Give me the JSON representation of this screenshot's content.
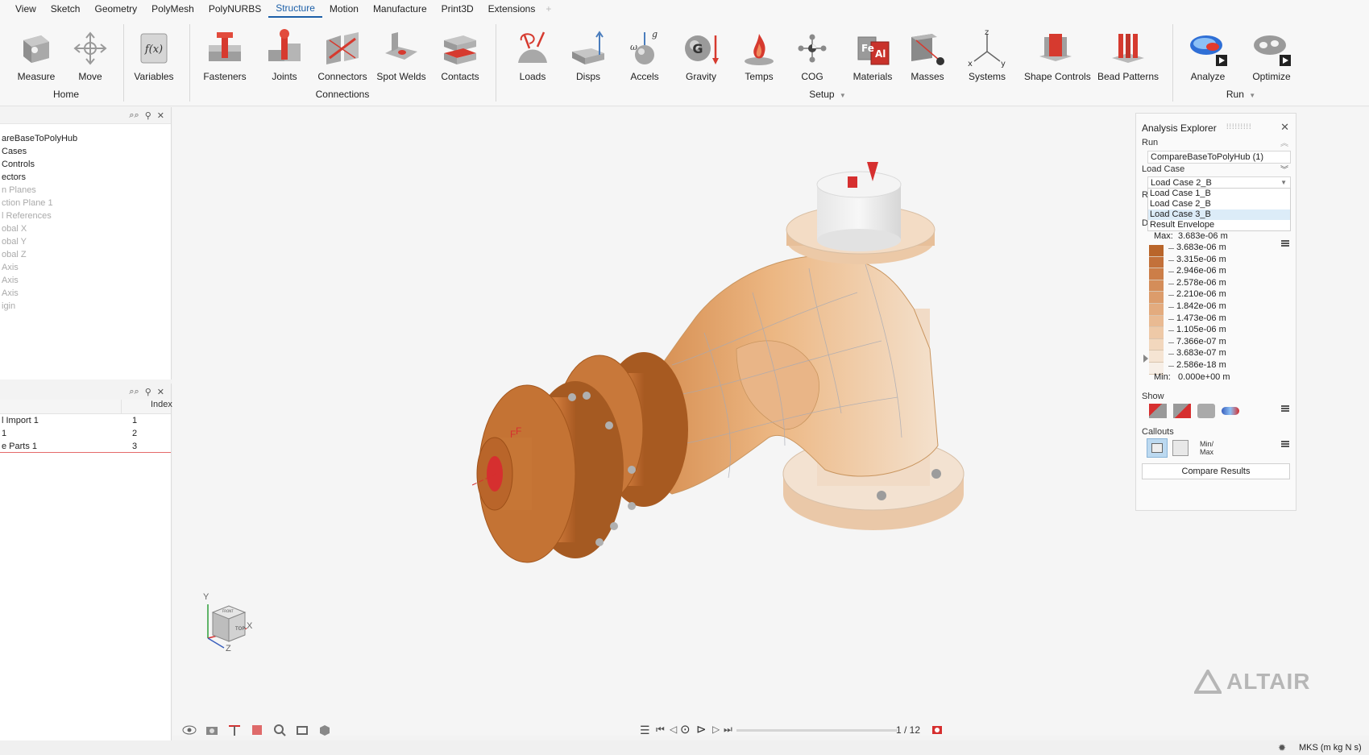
{
  "menubar": {
    "items": [
      "View",
      "Sketch",
      "Geometry",
      "PolyMesh",
      "PolyNURBS",
      "Structure",
      "Motion",
      "Manufacture",
      "Print3D",
      "Extensions"
    ],
    "active": "Structure",
    "plus": "+"
  },
  "ribbon": {
    "tools": {
      "measure": "Measure",
      "move": "Move",
      "variables": "Variables",
      "fasteners": "Fasteners",
      "joints": "Joints",
      "connectors": "Connectors",
      "spot_welds": "Spot Welds",
      "contacts": "Contacts",
      "loads": "Loads",
      "disps": "Disps",
      "accels": "Accels",
      "gravity": "Gravity",
      "temps": "Temps",
      "cog": "COG",
      "materials": "Materials",
      "masses": "Masses",
      "systems": "Systems",
      "shape_controls": "Shape Controls",
      "bead_patterns": "Bead Patterns",
      "analyze": "Analyze",
      "optimize": "Optimize"
    },
    "groups": {
      "home": "Home",
      "connections": "Connections",
      "setup": "Setup",
      "run": "Run"
    },
    "icon_text": {
      "variables_fx": "f(x)",
      "accels_omega": "ω",
      "accels_g": "g",
      "gravity_g": "G",
      "materials_fe": "Fe",
      "materials_al": "Al",
      "systems_x": "x",
      "systems_y": "y",
      "systems_z": "z"
    }
  },
  "model_browser": {
    "items": [
      {
        "label": "areBaseToPolyHub",
        "dim": false
      },
      {
        "label": "Cases",
        "dim": false
      },
      {
        "label": "Controls",
        "dim": false
      },
      {
        "label": "ectors",
        "dim": false
      },
      {
        "label": "n Planes",
        "dim": true
      },
      {
        "label": "ction Plane 1",
        "dim": true
      },
      {
        "label": "l References",
        "dim": true
      },
      {
        "label": "obal X",
        "dim": true
      },
      {
        "label": "obal Y",
        "dim": true
      },
      {
        "label": "obal Z",
        "dim": true
      },
      {
        "label": "Axis",
        "dim": true
      },
      {
        "label": "Axis",
        "dim": true
      },
      {
        "label": "Axis",
        "dim": true
      },
      {
        "label": "igin",
        "dim": true
      }
    ]
  },
  "property_table": {
    "header_index": "Index",
    "rows": [
      {
        "name": "l Import 1",
        "index": "1"
      },
      {
        "name": "1",
        "index": "2"
      },
      {
        "name": "e Parts 1",
        "index": "3"
      }
    ]
  },
  "explorer": {
    "title": "Analysis Explorer",
    "run_label": "Run",
    "run_value": "CompareBaseToPolyHub (1)",
    "load_case_label": "Load Case",
    "load_case_value": "Load Case 2_B",
    "options": [
      "Load Case 1_B",
      "Load Case 2_B",
      "Load Case 3_B",
      "Result Envelope"
    ],
    "selected_option_index": 2,
    "hidden_r": "R",
    "hidden_d": "D",
    "max_label": "Max:",
    "max_value": "3.683e-06 m",
    "legend_values": [
      "3.683e-06 m",
      "3.315e-06 m",
      "2.946e-06 m",
      "2.578e-06 m",
      "2.210e-06 m",
      "1.842e-06 m",
      "1.473e-06 m",
      "1.105e-06 m",
      "7.366e-07 m",
      "3.683e-07 m",
      "2.586e-18 m"
    ],
    "legend_colors": [
      "#b9652a",
      "#c3713a",
      "#cc7e48",
      "#d48d59",
      "#dc9c6b",
      "#e3ab7e",
      "#e9ba92",
      "#eec9a7",
      "#f2d7bd",
      "#f5e4d3",
      "#f7efe7"
    ],
    "min_label": "Min:",
    "min_value": "0.000e+00 m",
    "show_label": "Show",
    "callouts_label": "Callouts",
    "minmax_label": "Min/\nMax",
    "compare_button": "Compare Results"
  },
  "viewport": {
    "force_label": "F",
    "nav_cube": {
      "y": "Y",
      "x": "X",
      "z": "Z",
      "top": "TOP",
      "left_face": "FRONT"
    },
    "watermark": "ALTAIR"
  },
  "bottombar": {
    "frame": "1 / 12"
  },
  "statusbar": {
    "units": "MKS (m kg N s)"
  },
  "colors": {
    "accent": "#1c5fa8",
    "result_orange": "#c87a3e",
    "load_red": "#d62f2f"
  }
}
